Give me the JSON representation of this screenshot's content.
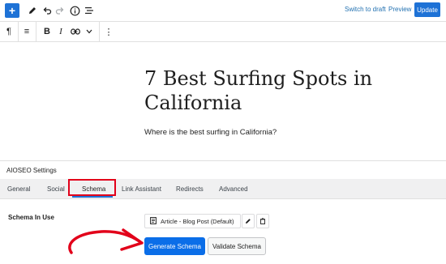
{
  "toolbar": {
    "switch_to_draft": "Switch to draft",
    "preview": "Preview",
    "update": "Update",
    "icons": [
      "plus-icon",
      "pen-icon",
      "undo-icon",
      "redo-icon",
      "info-icon",
      "list-view-icon"
    ]
  },
  "block_toolbar": {
    "paragraph_symbol": "¶",
    "align_symbol": "≡",
    "bold": "B",
    "italic": "I",
    "link_symbol": "⊖",
    "chevron": "∨",
    "more": "⋮"
  },
  "editor": {
    "title": "7 Best Surfing Spots in California",
    "paragraph": "Where is the best surfing in California?"
  },
  "aioseo": {
    "settings_title": "AIOSEO Settings",
    "tabs": [
      "General",
      "Social",
      "Schema",
      "Link Assistant",
      "Redirects",
      "Advanced"
    ],
    "active_tab": "Schema",
    "schema_in_use_label": "Schema In Use",
    "schema_item": "Article - Blog Post (Default)",
    "generate_button": "Generate Schema",
    "validate_button": "Validate Schema"
  },
  "colors": {
    "accent": "#1e72d6",
    "highlight_box": "#e2001a",
    "arrow": "#e2001a"
  }
}
